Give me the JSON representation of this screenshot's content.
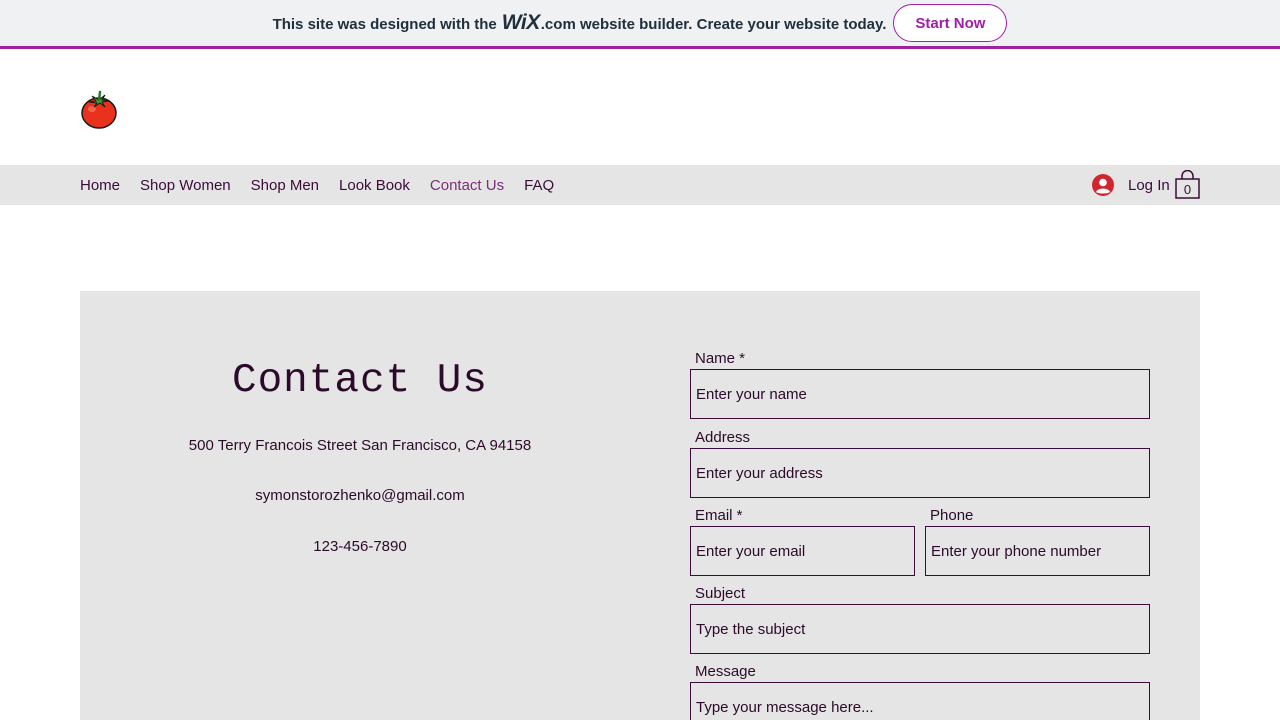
{
  "wix_banner": {
    "text_before": "This site was designed with the",
    "logo": "WiX",
    "text_after": ".com website builder. Create your website today.",
    "button_label": "Start Now"
  },
  "logo": {
    "icon": "tomato-icon"
  },
  "nav": {
    "items": [
      {
        "label": "Home",
        "active": false
      },
      {
        "label": "Shop Women",
        "active": false
      },
      {
        "label": "Shop Men",
        "active": false
      },
      {
        "label": "Look Book",
        "active": false
      },
      {
        "label": "Contact Us",
        "active": true
      },
      {
        "label": "FAQ",
        "active": false
      }
    ],
    "login_label": "Log In",
    "cart_count": "0"
  },
  "contact": {
    "title": "Contact Us",
    "address": "500 Terry Francois Street San Francisco, CA 94158",
    "email": "symonstorozhenko@gmail.com",
    "phone": "123-456-7890"
  },
  "form": {
    "name": {
      "label": "Name *",
      "placeholder": "Enter your name"
    },
    "address": {
      "label": "Address",
      "placeholder": "Enter your address"
    },
    "email": {
      "label": "Email *",
      "placeholder": "Enter your email"
    },
    "phone": {
      "label": "Phone",
      "placeholder": "Enter your phone number"
    },
    "subject": {
      "label": "Subject",
      "placeholder": "Type the subject"
    },
    "message": {
      "label": "Message",
      "placeholder": "Type your message here..."
    }
  },
  "colors": {
    "brand_purple": "#a01ea3",
    "text_dark": "#2b0a2a",
    "nav_active": "#7b2d7a",
    "panel_bg": "#e5e5e5",
    "avatar_red": "#d2262f"
  }
}
